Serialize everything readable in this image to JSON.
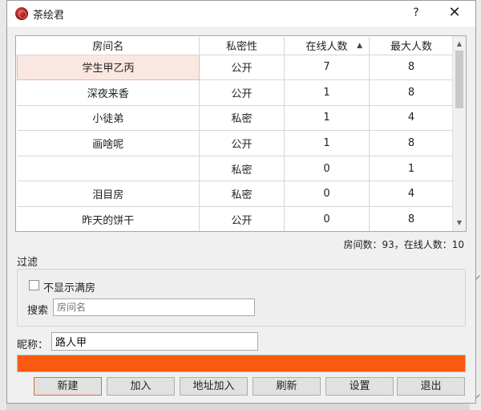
{
  "window": {
    "title": "茶绘君",
    "help_label": "?",
    "close_label": "✕"
  },
  "table": {
    "columns": [
      "房间名",
      "私密性",
      "在线人数",
      "最大人数"
    ],
    "sort_indicator": "▲",
    "rows": [
      [
        "学生甲乙丙",
        "公开",
        "7",
        "8"
      ],
      [
        "深夜来香",
        "公开",
        "1",
        "8"
      ],
      [
        "小徒弟",
        "私密",
        "1",
        "4"
      ],
      [
        "画啥呢",
        "公开",
        "1",
        "8"
      ],
      [
        "",
        "私密",
        "0",
        "1"
      ],
      [
        "泪目房",
        "私密",
        "0",
        "4"
      ],
      [
        "昨天的饼干",
        "公开",
        "0",
        "8"
      ]
    ],
    "scroll_up": "▲",
    "scroll_down": "▼"
  },
  "stats": "房间数：93，在线人数：10",
  "filter": {
    "label": "过滤",
    "hide_full_label": "不显示满房",
    "hide_full_checked": false,
    "search_label": "搜索",
    "search_placeholder": "房间名",
    "search_value": ""
  },
  "nickname": {
    "label": "昵称：",
    "value": "路人甲"
  },
  "progress": {
    "value_percent": 100,
    "color": "#fa5a0f"
  },
  "buttons": {
    "new": "新建",
    "join": "加入",
    "join_by_address": "地址加入",
    "refresh": "刷新",
    "settings": "设置",
    "exit": "退出"
  }
}
